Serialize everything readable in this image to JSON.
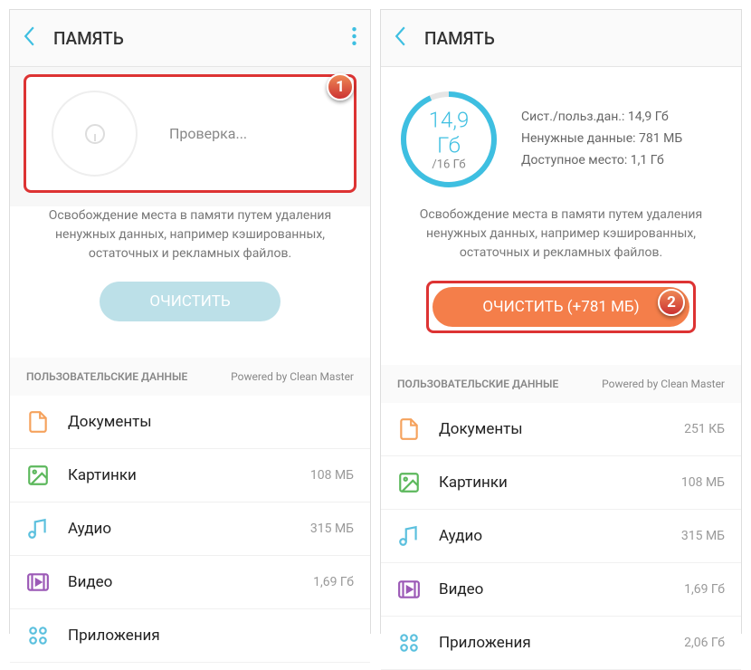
{
  "left": {
    "title": "ПАМЯТЬ",
    "checkingText": "Проверка...",
    "description": "Освобождение места в памяти путем удаления ненужных данных, например кэшированных, остаточных и рекламных файлов.",
    "cleanButton": "ОЧИСТИТЬ",
    "listHeader": "ПОЛЬЗОВАТЕЛЬСКИЕ ДАННЫЕ",
    "poweredBy": "Powered by Clean Master",
    "badge": "1",
    "items": [
      {
        "label": "Документы",
        "size": "",
        "iconColor": "#f5a25d"
      },
      {
        "label": "Картинки",
        "size": "108 МБ",
        "iconColor": "#5cb85c"
      },
      {
        "label": "Аудио",
        "size": "315 МБ",
        "iconColor": "#5bc0de"
      },
      {
        "label": "Видео",
        "size": "1,69 Гб",
        "iconColor": "#9b59b6"
      },
      {
        "label": "Приложения",
        "size": "",
        "iconColor": "#5bc0de"
      }
    ]
  },
  "right": {
    "title": "ПАМЯТЬ",
    "gaugeValue": "14,9 Гб",
    "gaugeTotal": "/16 Гб",
    "statLine1": "Сист./польз.дан.: 14,9 Гб",
    "statLine2": "Ненужные данные: 781 МБ",
    "statLine3": "Доступное место: 1,1 Гб",
    "description": "Освобождение места в памяти путем удаления ненужных данных, например кэшированных, остаточных и рекламных файлов.",
    "cleanButton": "ОЧИСТИТЬ (+781 МБ)",
    "listHeader": "ПОЛЬЗОВАТЕЛЬСКИЕ ДАННЫЕ",
    "poweredBy": "Powered by Clean Master",
    "badge": "2",
    "items": [
      {
        "label": "Документы",
        "size": "251 КБ",
        "iconColor": "#f5a25d"
      },
      {
        "label": "Картинки",
        "size": "108 МБ",
        "iconColor": "#5cb85c"
      },
      {
        "label": "Аудио",
        "size": "315 МБ",
        "iconColor": "#5bc0de"
      },
      {
        "label": "Видео",
        "size": "1,69 Гб",
        "iconColor": "#9b59b6"
      },
      {
        "label": "Приложения",
        "size": "2,06 Гб",
        "iconColor": "#5bc0de"
      }
    ]
  }
}
